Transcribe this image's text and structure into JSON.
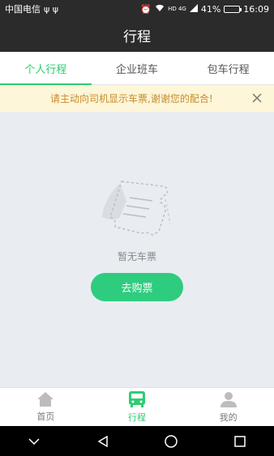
{
  "status_bar": {
    "carrier": "中国电信",
    "usb_icons": "ψ ψ",
    "signal_text": "HD 4G",
    "battery_percent": "41%",
    "battery_level": 0.41,
    "time": "16:09"
  },
  "title": "行程",
  "tabs": [
    {
      "label": "个人行程",
      "active": true
    },
    {
      "label": "企业班车",
      "active": false
    },
    {
      "label": "包车行程",
      "active": false
    }
  ],
  "notice": {
    "text": "请主动向司机显示车票,谢谢您的配合!"
  },
  "empty": {
    "text": "暂无车票",
    "button_label": "去购票"
  },
  "bottom_nav": [
    {
      "label": "首页",
      "icon": "home-icon",
      "active": false
    },
    {
      "label": "行程",
      "icon": "bus-icon",
      "active": true
    },
    {
      "label": "我的",
      "icon": "user-icon",
      "active": false
    }
  ],
  "colors": {
    "accent": "#2ecc71",
    "notice_text": "#c98a2e",
    "notice_bg": "#fdf6d8",
    "header_bg": "#2b2b2b"
  }
}
